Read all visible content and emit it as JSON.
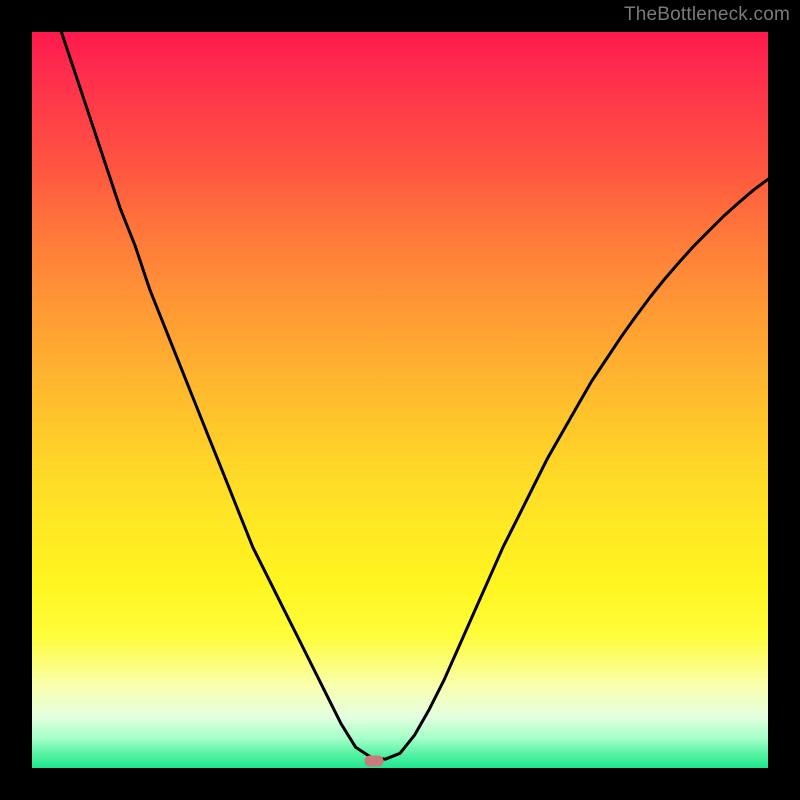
{
  "watermark": "TheBottleneck.com",
  "chart_data": {
    "type": "line",
    "title": "",
    "xlabel": "",
    "ylabel": "",
    "xlim": [
      0,
      100
    ],
    "ylim": [
      0,
      100
    ],
    "grid": false,
    "legend": false,
    "background_gradient": {
      "top_color": "#ff1a4d",
      "bottom_color": "#1de88f",
      "description": "vertical red-to-green heat gradient"
    },
    "series": [
      {
        "name": "bottleneck-curve",
        "color": "#000000",
        "x": [
          4,
          6,
          8,
          10,
          12,
          14,
          16,
          18,
          20,
          22,
          24,
          26,
          28,
          30,
          32,
          34,
          36,
          38,
          40,
          42,
          44,
          46,
          48,
          50,
          52,
          54,
          56,
          58,
          60,
          62,
          64,
          66,
          68,
          70,
          72,
          74,
          76,
          78,
          80,
          82,
          84,
          86,
          88,
          90,
          92,
          94,
          96,
          98,
          100
        ],
        "y": [
          100,
          94,
          88,
          82,
          76,
          71,
          65,
          60,
          55,
          50,
          45,
          40,
          35,
          30,
          26,
          22,
          18,
          14,
          10,
          6,
          2.8,
          1.5,
          1.2,
          2.0,
          4.5,
          8.0,
          12.0,
          16.5,
          21.0,
          25.5,
          30.0,
          34.0,
          38.0,
          42.0,
          45.5,
          49.0,
          52.5,
          55.5,
          58.5,
          61.3,
          64.0,
          66.5,
          68.8,
          71.0,
          73.0,
          75.0,
          76.8,
          78.5,
          80.0
        ]
      }
    ],
    "marker": {
      "name": "optimal-point",
      "x": 46.5,
      "y": 1.0,
      "color": "#c97a7a"
    }
  }
}
